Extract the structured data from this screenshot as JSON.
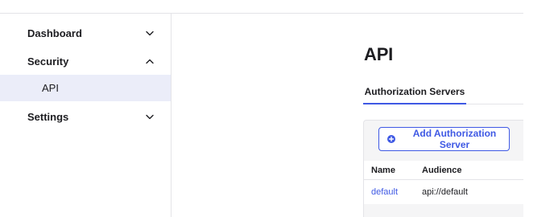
{
  "sidebar": {
    "items": [
      {
        "label": "Dashboard",
        "chevron": "chevron-down"
      },
      {
        "label": "Security",
        "chevron": "chevron-up"
      },
      {
        "label": "API"
      },
      {
        "label": "Settings",
        "chevron": "chevron-down"
      }
    ]
  },
  "main": {
    "title": "API",
    "tabs": [
      {
        "label": "Authorization Servers"
      }
    ],
    "add_button": {
      "label": "Add Authorization Server",
      "icon": "plus-circle-icon"
    },
    "table": {
      "headers": [
        "Name",
        "Audience"
      ],
      "rows": [
        {
          "name": "default",
          "audience": "api://default"
        }
      ]
    }
  },
  "colors": {
    "accent": "#3f59e4",
    "selected_bg": "#ebedf9",
    "border": "#e4e4e8",
    "panel_bg": "#f5f5f6"
  }
}
